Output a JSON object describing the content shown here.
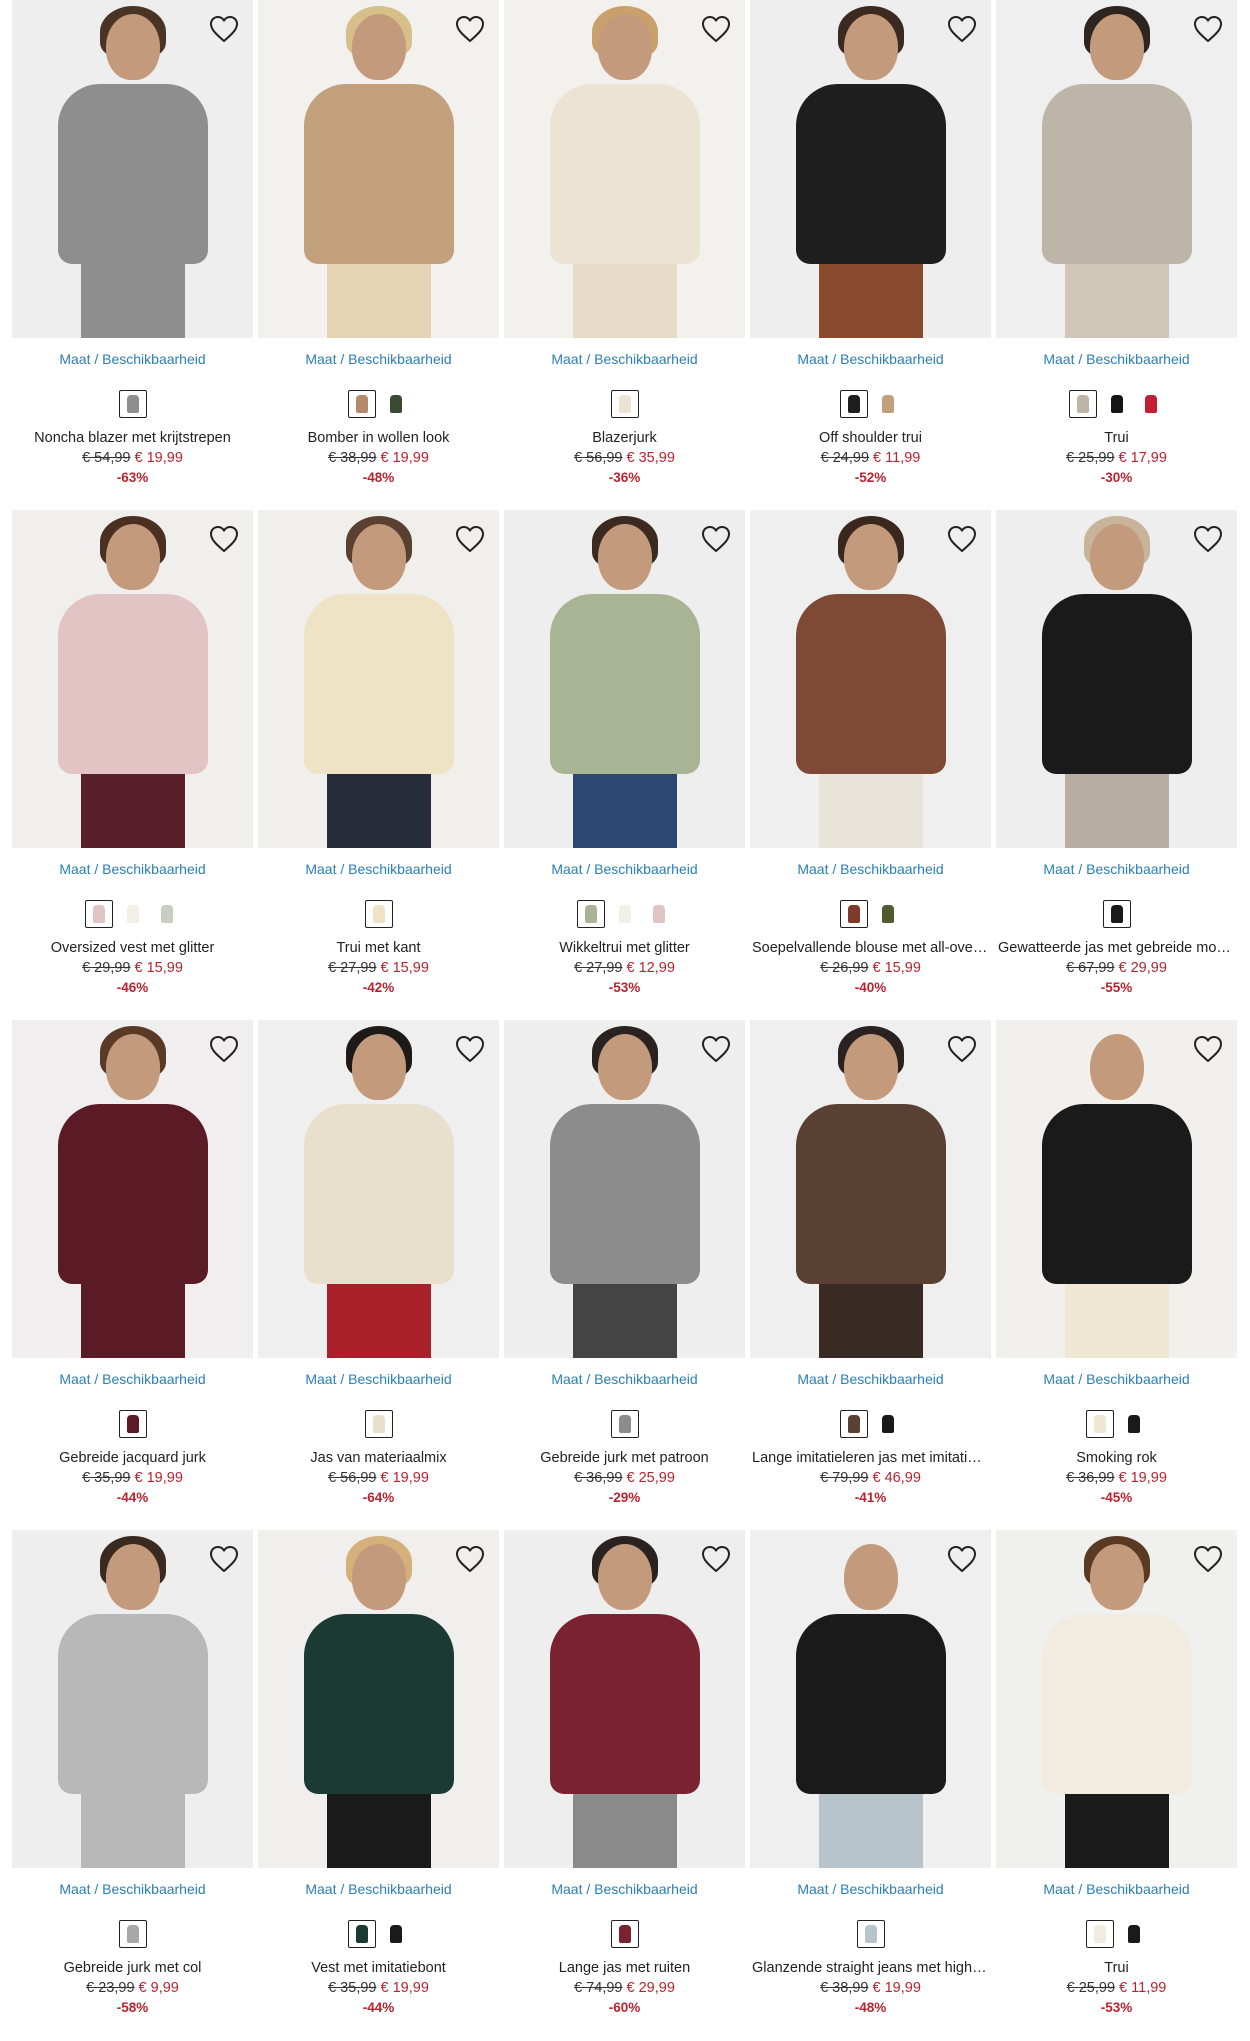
{
  "availability_label": "Maat / Beschikbaarheid",
  "products": [
    {
      "name": "Noncha blazer met krijtstrepen",
      "old_price": "€ 54,99",
      "new_price": "€ 19,99",
      "discount": "-63%",
      "bg": "#eeeeee",
      "top": "#8e8e8e",
      "bottom": "#8e8e8e",
      "hair": "#4a3426",
      "swatches": [
        "#8e8e8e"
      ]
    },
    {
      "name": "Bomber in wollen look",
      "old_price": "€ 38,99",
      "new_price": "€ 19,99",
      "discount": "-48%",
      "bg": "#f3f1ee",
      "top": "#c3a07c",
      "bottom": "#e4d4b4",
      "hair": "#d7bf8a",
      "swatches": [
        "#b58a6a",
        "#3a4a30"
      ]
    },
    {
      "name": "Blazerjurk",
      "old_price": "€ 56,99",
      "new_price": "€ 35,99",
      "discount": "-36%",
      "bg": "#f2f1ee",
      "top": "#ede3d2",
      "bottom": "#e8dcc8",
      "hair": "#c9a06a",
      "swatches": [
        "#ede3d2"
      ]
    },
    {
      "name": "Off shoulder trui",
      "old_price": "€ 24,99",
      "new_price": "€ 11,99",
      "discount": "-52%",
      "bg": "#eeeeee",
      "top": "#1e1e1e",
      "bottom": "#8a4a2e",
      "hair": "#3c2a20",
      "swatches": [
        "#1e1e1e",
        "#c3a07c"
      ]
    },
    {
      "name": "Trui",
      "old_price": "€ 25,99",
      "new_price": "€ 17,99",
      "discount": "-30%",
      "bg": "#efefef",
      "top": "#bdb5a8",
      "bottom": "#cfc6b8",
      "hair": "#2e2420",
      "swatches": [
        "#bdb5a8",
        "#151515",
        "#c41e32"
      ]
    },
    {
      "name": "Oversized vest met glitter",
      "old_price": "€ 29,99",
      "new_price": "€ 15,99",
      "discount": "-46%",
      "bg": "#f1eeee",
      "top": "#e2c4c4",
      "bottom": "#5a1f2a",
      "hair": "#4a3020",
      "swatches": [
        "#e2c4c4",
        "#f2efe6",
        "#c8cfc2"
      ]
    },
    {
      "name": "Trui met kant",
      "old_price": "€ 27,99",
      "new_price": "€ 15,99",
      "discount": "-42%",
      "bg": "#f0efec",
      "top": "#efe3c6",
      "bottom": "#262c3a",
      "hair": "#5a4030",
      "swatches": [
        "#efe3c6"
      ]
    },
    {
      "name": "Wikkeltrui met glitter",
      "old_price": "€ 27,99",
      "new_price": "€ 12,99",
      "discount": "-53%",
      "bg": "#eeeeee",
      "top": "#a9b494",
      "bottom": "#2c4872",
      "hair": "#3a2a20",
      "swatches": [
        "#a9b494",
        "#f2efe6",
        "#e2c4c4"
      ]
    },
    {
      "name": "Soepelvallende blouse met all-over print",
      "old_price": "€ 26,99",
      "new_price": "€ 15,99",
      "discount": "-40%",
      "bg": "#efefef",
      "top": "#7e4a36",
      "bottom": "#e9e4da",
      "hair": "#3a281e",
      "swatches": [
        "#7e3a2c",
        "#4e5a30"
      ]
    },
    {
      "name": "Gewatteerde jas met gebreide mouwen",
      "old_price": "€ 67,99",
      "new_price": "€ 29,99",
      "discount": "-55%",
      "bg": "#eeeeee",
      "top": "#1a1a1a",
      "bottom": "#b8aea2",
      "hair": "#c7b49a",
      "swatches": [
        "#1a1a1a"
      ]
    },
    {
      "name": "Gebreide jacquard jurk",
      "old_price": "€ 35,99",
      "new_price": "€ 19,99",
      "discount": "-44%",
      "bg": "#f0eeee",
      "top": "#5a1a26",
      "bottom": "#5a1a26",
      "hair": "#5a3a26",
      "swatches": [
        "#5a1a26"
      ]
    },
    {
      "name": "Jas van materiaalmix",
      "old_price": "€ 56,99",
      "new_price": "€ 19,99",
      "discount": "-64%",
      "bg": "#efefef",
      "top": "#e8e0cc",
      "bottom": "#a8202a",
      "hair": "#1e1a18",
      "swatches": [
        "#e8e0cc"
      ]
    },
    {
      "name": "Gebreide jurk met patroon",
      "old_price": "€ 36,99",
      "new_price": "€ 25,99",
      "discount": "-29%",
      "bg": "#eeeeee",
      "top": "#8c8c8c",
      "bottom": "#444444",
      "hair": "#2a2220",
      "swatches": [
        "#8c8c8c"
      ]
    },
    {
      "name": "Lange imitatieleren jas met imitatiebont",
      "old_price": "€ 79,99",
      "new_price": "€ 46,99",
      "discount": "-41%",
      "bg": "#efefef",
      "top": "#5a4032",
      "bottom": "#3a2a24",
      "hair": "#2a2220",
      "swatches": [
        "#5a4032",
        "#1a1a1a"
      ]
    },
    {
      "name": "Smoking rok",
      "old_price": "€ 36,99",
      "new_price": "€ 19,99",
      "discount": "-45%",
      "bg": "#f1f0ed",
      "top": "#1a1a1a",
      "bottom": "#efe7d4",
      "hair": "#f1f0ed",
      "swatches": [
        "#efe7d4",
        "#1a1a1a"
      ]
    },
    {
      "name": "Gebreide jurk met col",
      "old_price": "€ 23,99",
      "new_price": "€ 9,99",
      "discount": "-58%",
      "bg": "#eeeeee",
      "top": "#b8b8b8",
      "bottom": "#b8b8b8",
      "hair": "#3a2a20",
      "swatches": [
        "#a8a8a8"
      ]
    },
    {
      "name": "Vest met imitatiebont",
      "old_price": "€ 35,99",
      "new_price": "€ 19,99",
      "discount": "-44%",
      "bg": "#f0efee",
      "top": "#1c3a34",
      "bottom": "#1a1a1a",
      "hair": "#d4b07a",
      "swatches": [
        "#1c3a34",
        "#1a1a1a"
      ]
    },
    {
      "name": "Lange jas met ruiten",
      "old_price": "€ 74,99",
      "new_price": "€ 29,99",
      "discount": "-60%",
      "bg": "#eeeeee",
      "top": "#7a2230",
      "bottom": "#8a8a8a",
      "hair": "#2a2220",
      "swatches": [
        "#7a2230"
      ]
    },
    {
      "name": "Glanzende straight jeans met high waist",
      "old_price": "€ 38,99",
      "new_price": "€ 19,99",
      "discount": "-48%",
      "bg": "#efefef",
      "top": "#1a1a1a",
      "bottom": "#b8c4cc",
      "hair": "#efefef",
      "swatches": [
        "#b8c4cc"
      ]
    },
    {
      "name": "Trui",
      "old_price": "€ 25,99",
      "new_price": "€ 11,99",
      "discount": "-53%",
      "bg": "#f0f0ee",
      "top": "#f1ecdf",
      "bottom": "#1a1a1a",
      "hair": "#5a3a22",
      "swatches": [
        "#f1ecdf",
        "#1a1a1a"
      ]
    }
  ]
}
